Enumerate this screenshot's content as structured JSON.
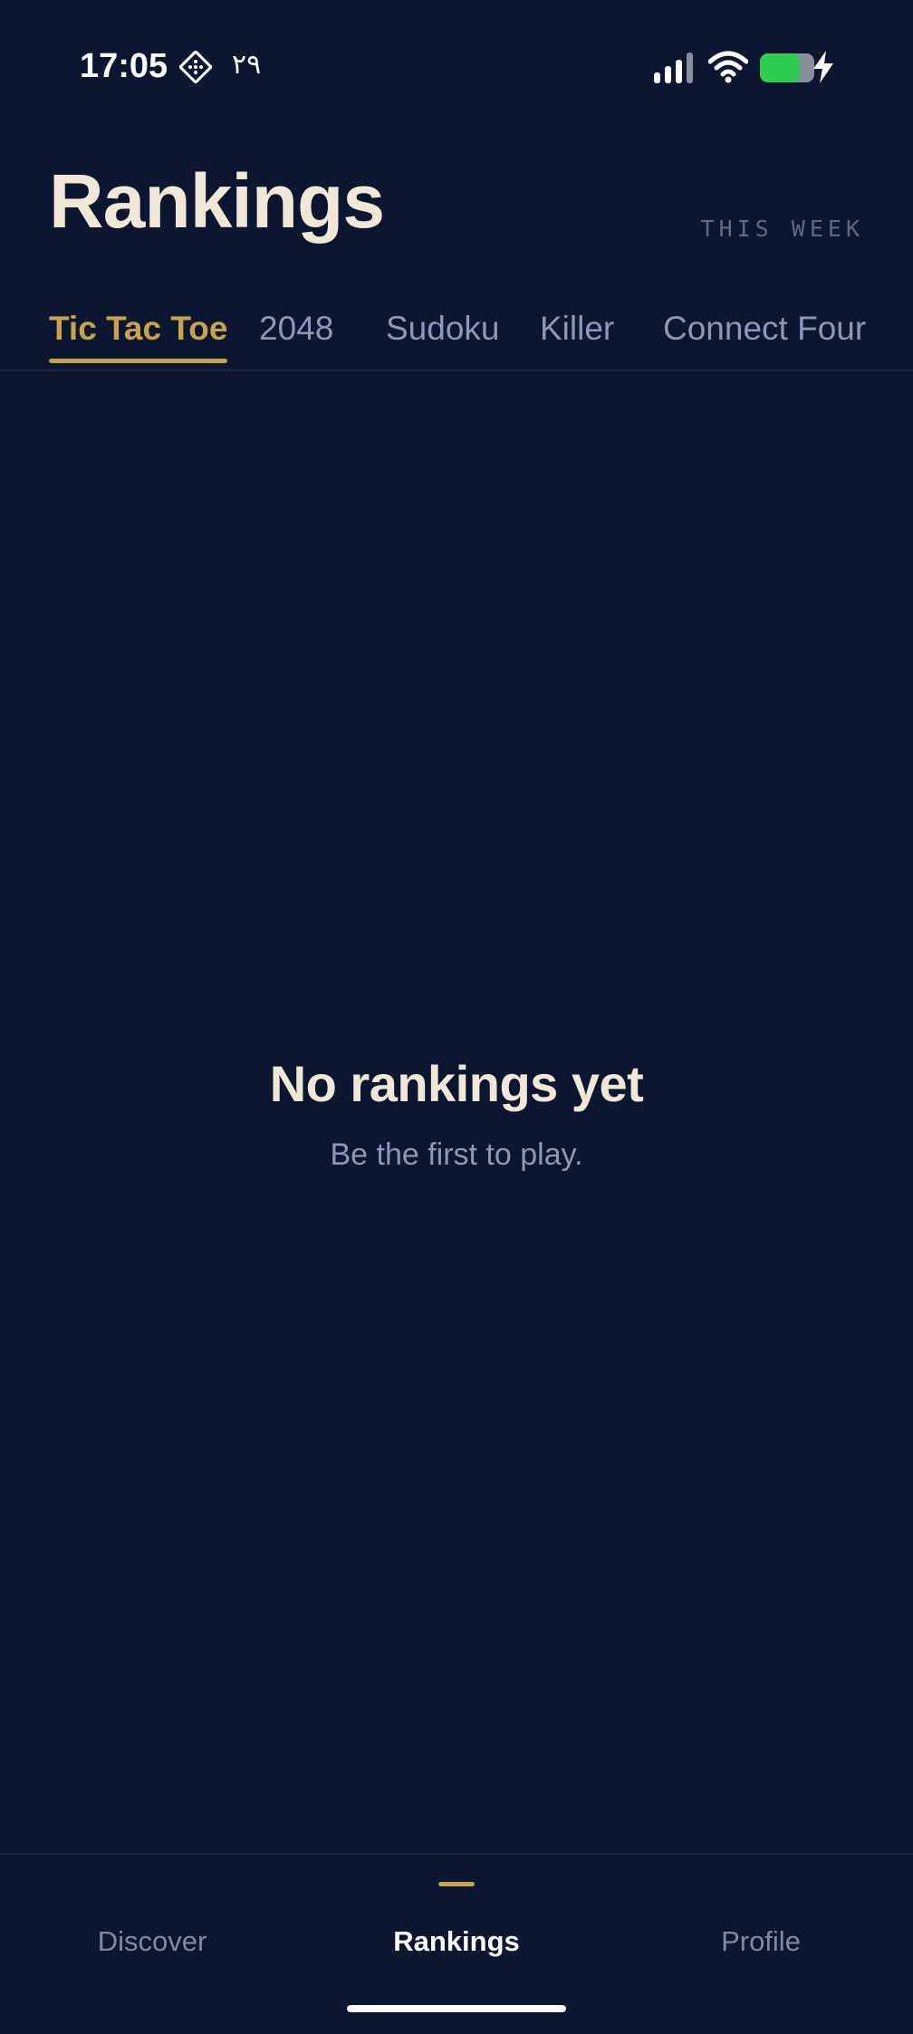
{
  "status_bar": {
    "time": "17:05",
    "arabic_text": "۲۹",
    "status_icon": "diamond-grid-icon",
    "signal_icon": "cellular-signal-icon",
    "wifi_icon": "wifi-icon",
    "battery_icon": "battery-icon",
    "charging_icon": "bolt-icon",
    "battery_color": "#2ecc4f"
  },
  "header": {
    "title": "Rankings",
    "period": "THIS WEEK"
  },
  "tabs": [
    {
      "label": "Tic Tac Toe",
      "active": true
    },
    {
      "label": "2048",
      "active": false
    },
    {
      "label": "Sudoku",
      "active": false
    },
    {
      "label": "Killer",
      "active": false
    },
    {
      "label": "Connect Four",
      "active": false
    }
  ],
  "empty_state": {
    "title": "No rankings yet",
    "subtitle": "Be the first to play."
  },
  "bottom_nav": {
    "items": [
      {
        "label": "Discover",
        "active": false
      },
      {
        "label": "Rankings",
        "active": true
      },
      {
        "label": "Profile",
        "active": false
      }
    ]
  },
  "colors": {
    "background": "#0b1630",
    "accent": "#c9a24e",
    "title_text": "#f1e7d6",
    "muted_text": "#8c98b8"
  }
}
